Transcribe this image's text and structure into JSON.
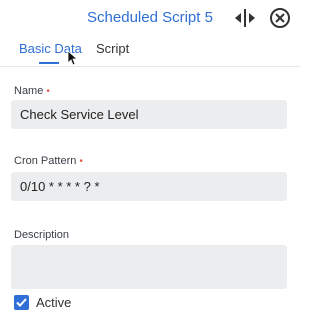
{
  "header": {
    "title": "Scheduled Script 5",
    "icons": {
      "resize": "resize-horizontal-icon",
      "close": "close-circle-icon"
    }
  },
  "tabs": [
    {
      "label": "Basic Data",
      "active": true
    },
    {
      "label": "Script",
      "active": false
    }
  ],
  "form": {
    "name": {
      "label": "Name",
      "required_mark": "•",
      "value": "Check Service Level"
    },
    "cron": {
      "label": "Cron Pattern",
      "required_mark": "•",
      "value": "0/10 * * * * ? *"
    },
    "description": {
      "label": "Description",
      "value": ""
    },
    "active": {
      "label": "Active",
      "checked": true
    }
  },
  "colors": {
    "accent": "#2f6fd6",
    "required": "#e25c4f",
    "field_bg": "#ecedef"
  }
}
